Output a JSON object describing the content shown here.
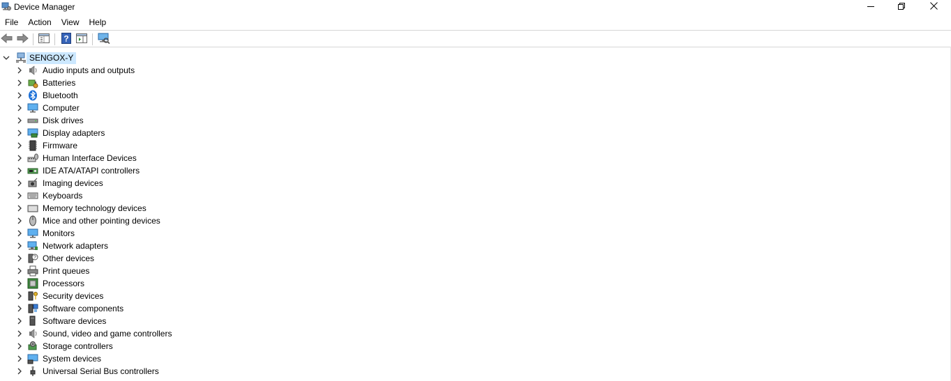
{
  "window": {
    "title": "Device Manager",
    "icon": "device-manager-icon",
    "controls": [
      "minimize-icon",
      "restore-icon",
      "close-icon"
    ]
  },
  "menu": [
    "File",
    "Action",
    "View",
    "Help"
  ],
  "toolbar": {
    "buttons": [
      "back-arrow-icon",
      "forward-arrow-icon",
      "properties-icon",
      "help-icon",
      "action-pane-icon",
      "scan-hardware-icon"
    ]
  },
  "tree": {
    "root": {
      "label": "SENGOX-Y",
      "icon": "computer-network-icon",
      "expanded": true
    },
    "categories": [
      {
        "label": "Audio inputs and outputs",
        "icon": "speaker-icon"
      },
      {
        "label": "Batteries",
        "icon": "battery-icon"
      },
      {
        "label": "Bluetooth",
        "icon": "bluetooth-icon"
      },
      {
        "label": "Computer",
        "icon": "monitor-icon"
      },
      {
        "label": "Disk drives",
        "icon": "disk-drive-icon"
      },
      {
        "label": "Display adapters",
        "icon": "display-adapter-icon"
      },
      {
        "label": "Firmware",
        "icon": "chip-icon"
      },
      {
        "label": "Human Interface Devices",
        "icon": "hid-icon"
      },
      {
        "label": "IDE ATA/ATAPI controllers",
        "icon": "ide-controller-icon"
      },
      {
        "label": "Imaging devices",
        "icon": "camera-icon"
      },
      {
        "label": "Keyboards",
        "icon": "keyboard-icon"
      },
      {
        "label": "Memory technology devices",
        "icon": "memory-icon"
      },
      {
        "label": "Mice and other pointing devices",
        "icon": "mouse-icon"
      },
      {
        "label": "Monitors",
        "icon": "monitor-icon"
      },
      {
        "label": "Network adapters",
        "icon": "network-adapter-icon"
      },
      {
        "label": "Other devices",
        "icon": "unknown-device-icon"
      },
      {
        "label": "Print queues",
        "icon": "printer-icon"
      },
      {
        "label": "Processors",
        "icon": "processor-icon"
      },
      {
        "label": "Security devices",
        "icon": "security-key-icon"
      },
      {
        "label": "Software components",
        "icon": "software-component-icon"
      },
      {
        "label": "Software devices",
        "icon": "software-device-icon"
      },
      {
        "label": "Sound, video and game controllers",
        "icon": "speaker-icon"
      },
      {
        "label": "Storage controllers",
        "icon": "storage-controller-icon"
      },
      {
        "label": "System devices",
        "icon": "system-device-icon"
      },
      {
        "label": "Universal Serial Bus controllers",
        "icon": "usb-icon"
      }
    ]
  },
  "colors": {
    "selection": "#cce8ff",
    "blue_icon": "#2f7fd3",
    "toolbar_sep": "#c8c8c8"
  }
}
